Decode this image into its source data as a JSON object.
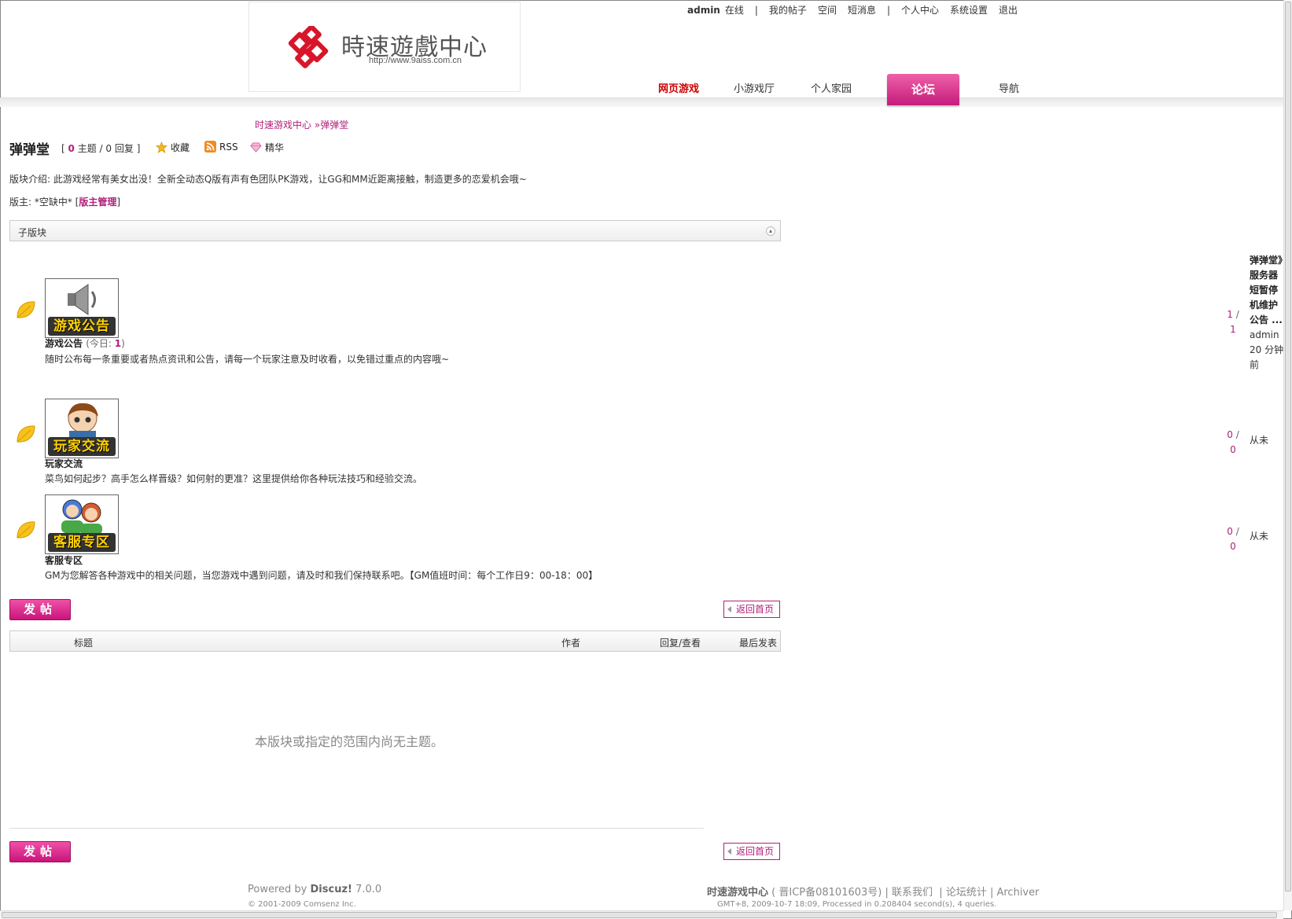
{
  "header": {
    "logo_title": "時速遊戲中心",
    "logo_url": "http://www.9aiss.com.cn"
  },
  "topbar": {
    "user": "admin",
    "online": "在线",
    "sep": "|",
    "my_posts": "我的帖子",
    "space": "空间",
    "messages": "短消息",
    "user_center": "个人中心",
    "settings": "系统设置",
    "logout": "退出"
  },
  "nav": [
    {
      "label": "网页游戏"
    },
    {
      "label": "小游戏厅"
    },
    {
      "label": "个人家园"
    },
    {
      "label": "论坛"
    },
    {
      "label": "导航"
    }
  ],
  "breadcrumb": {
    "home": "时速游戏中心",
    "sep": "»",
    "current": "弹弹堂"
  },
  "forum": {
    "title": "弹弹堂",
    "stats_open": "[",
    "topics": "0",
    "topics_label": "主题",
    "slash": "/",
    "replies": "0",
    "replies_label": "回复",
    "stats_close": "]",
    "favorite": "收藏",
    "rss": "RSS",
    "digest": "精华",
    "intro": "版块介绍: 此游戏经常有美女出没！全新全动态Q版有声有色团队PK游戏，让GG和MM近距离接触，制造更多的恋爱机会哦~",
    "moderator_label": "版主: *空缺中*",
    "moderator_admin": "版主管理"
  },
  "subforum_bar": {
    "label": "子版块",
    "toggle": "▴"
  },
  "subforums": [
    {
      "badge": "游戏公告",
      "name": "游戏公告",
      "today_label": "(今日:",
      "today_count": "1",
      "today_close": ")",
      "desc": "随时公布每一条重要或者热点资讯和公告，请每一个玩家注意及时收看，以免错过重点的内容哦~",
      "threads": "1",
      "posts": "1",
      "last_post": "弹弹堂》服务器短暂停机维护公告 ...",
      "last_user": "admin",
      "last_time": "20 分钟前"
    },
    {
      "badge": "玩家交流",
      "name": "玩家交流",
      "desc": "菜鸟如何起步？高手怎么样晋级？如何射的更准？这里提供给你各种玩法技巧和经验交流。",
      "threads": "0",
      "posts": "0",
      "last_post": "从未"
    },
    {
      "badge": "客服专区",
      "name": "客服专区",
      "desc": "GM为您解答各种游戏中的相关问题，当您游戏中遇到问题，请及时和我们保持联系吧。【GM值班时间：每个工作日9：00-18：00】",
      "threads": "0",
      "posts": "0",
      "last_post": "从未"
    }
  ],
  "actions": {
    "post": "发帖",
    "back_home": "返回首页"
  },
  "thread_header": {
    "title": "标题",
    "author": "作者",
    "replies_views": "回复/查看",
    "last_post": "最后发表"
  },
  "empty_message": "本版块或指定的范围内尚无主题。",
  "footer": {
    "powered_prefix": "Powered by",
    "powered_name": "Discuz!",
    "powered_version": "7.0.0",
    "copyright": "© 2001-2009 Comsenz Inc.",
    "site_name": "时速游戏中心",
    "icp": "( 晋ICP备08101603号)",
    "contact": "联系我们",
    "stats": "论坛统计",
    "archiver": "Archiver",
    "info": "GMT+8, 2009-10-7 18:09, Processed in 0.208404 second(s), 4 queries."
  },
  "colors": {
    "accent": "#b0207a",
    "nav_active": "#d8288c",
    "hot": "#cc0000"
  }
}
